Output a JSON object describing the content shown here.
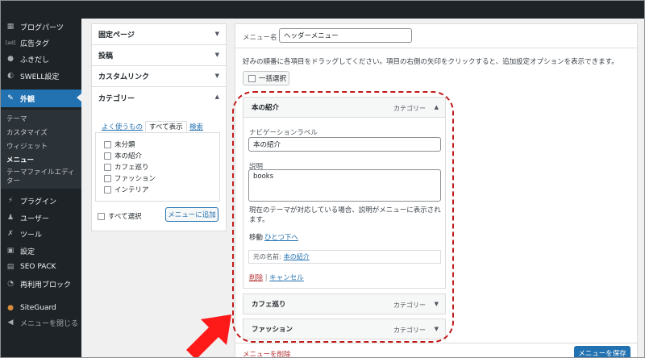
{
  "sidebar": {
    "items": [
      {
        "label": "ブログパーツ",
        "icon": "grid-icon"
      },
      {
        "label": "広告タグ",
        "icon": "ad-icon"
      },
      {
        "label": "ふきだし",
        "icon": "speech-bubble-icon"
      },
      {
        "label": "SWELL設定",
        "icon": "toggle-icon"
      },
      {
        "label": "外観",
        "icon": "brush-icon"
      },
      {
        "label": "プラグイン",
        "icon": "plug-icon"
      },
      {
        "label": "ユーザー",
        "icon": "user-icon"
      },
      {
        "label": "ツール",
        "icon": "wrench-icon"
      },
      {
        "label": "設定",
        "icon": "settings-icon"
      },
      {
        "label": "SEO PACK",
        "icon": "seo-icon"
      },
      {
        "label": "再利用ブロック",
        "icon": "reuse-icon"
      },
      {
        "label": "SiteGuard",
        "icon": "siteguard-icon"
      },
      {
        "label": "メニューを閉じる",
        "icon": "collapse-icon"
      }
    ],
    "submenu": [
      "テーマ",
      "カスタマイズ",
      "ウィジェット",
      "メニュー",
      "テーマファイルエディター"
    ]
  },
  "left_panel": {
    "sections": [
      "固定ページ",
      "投稿",
      "カスタムリンク",
      "カテゴリー"
    ],
    "tabs": [
      "よく使うもの",
      "すべて表示",
      "検索"
    ],
    "categories": [
      "未分類",
      "本の紹介",
      "カフェ巡り",
      "ファッション",
      "インテリア"
    ],
    "select_all": "すべて選択",
    "add_button": "メニューに追加"
  },
  "right_panel": {
    "menu_name_label": "メニュー名",
    "menu_name_value": "ヘッダーメニュー",
    "instructions": "好みの順番に各項目をドラッグしてください。項目の右側の矢印をクリックすると、追加設定オプションを表示できます。",
    "bulk_select": "一括選択",
    "items": [
      {
        "title": "本の紹介",
        "type": "カテゴリー"
      },
      {
        "title": "カフェ巡り",
        "type": "カテゴリー"
      },
      {
        "title": "ファッション",
        "type": "カテゴリー"
      }
    ],
    "edit": {
      "nav_label_label": "ナビゲーションラベル",
      "nav_label_value": "本の紹介",
      "description_label": "説明",
      "description_value": "books",
      "description_help": "現在のテーマが対応している場合、説明がメニューに表示されます。",
      "move_label": "移動",
      "move_link": "ひとつ下へ",
      "original_label": "元の名前:",
      "original_link": "本の紹介",
      "remove": "削除",
      "separator": "|",
      "cancel": "キャンセル"
    },
    "delete_menu": "メニューを削除",
    "save_button": "メニューを保存"
  },
  "colors": {
    "accent": "#2271b1",
    "highlight": "#c01b1b",
    "sidebar": "#1d2327"
  }
}
